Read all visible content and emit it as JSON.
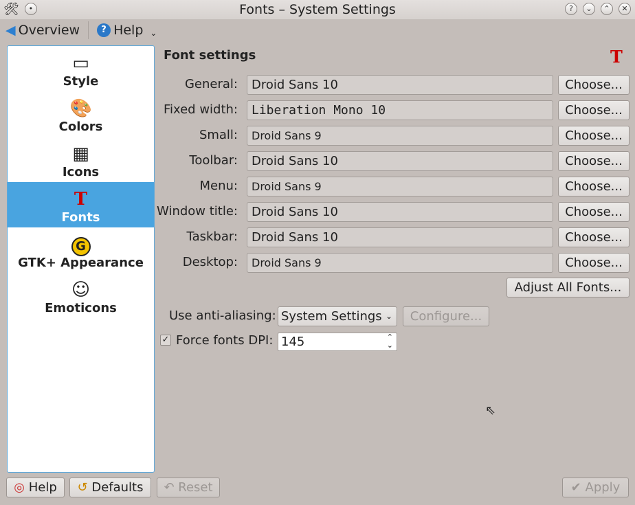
{
  "window": {
    "title": "Fonts – System Settings"
  },
  "toolbar": {
    "overview": "Overview",
    "help": "Help"
  },
  "sidebar": {
    "items": [
      {
        "label": "Style",
        "icon": "style-icon",
        "selected": false
      },
      {
        "label": "Colors",
        "icon": "colors-icon",
        "selected": false
      },
      {
        "label": "Icons",
        "icon": "icons-icon",
        "selected": false
      },
      {
        "label": "Fonts",
        "icon": "fonts-icon",
        "selected": true
      },
      {
        "label": "GTK+ Appearance",
        "icon": "gtk-icon",
        "selected": false
      },
      {
        "label": "Emoticons",
        "icon": "emoticons-icon",
        "selected": false
      }
    ]
  },
  "main": {
    "heading": "Font settings",
    "choose_label": "Choose...",
    "fonts": [
      {
        "label": "General:",
        "value": "Droid Sans 10"
      },
      {
        "label": "Fixed width:",
        "value": "Liberation Mono 10"
      },
      {
        "label": "Small:",
        "value": "Droid Sans 9"
      },
      {
        "label": "Toolbar:",
        "value": "Droid Sans 10"
      },
      {
        "label": "Menu:",
        "value": "Droid Sans 9"
      },
      {
        "label": "Window title:",
        "value": "Droid Sans 10"
      },
      {
        "label": "Taskbar:",
        "value": "Droid Sans 10"
      },
      {
        "label": "Desktop:",
        "value": "Droid Sans 9"
      }
    ],
    "adjust_all": "Adjust All Fonts...",
    "antialias_label": "Use anti-aliasing:",
    "antialias_value": "System Settings",
    "configure": "Configure...",
    "dpi_label": "Force fonts DPI:",
    "dpi_checked": true,
    "dpi_value": "145"
  },
  "footer": {
    "help": "Help",
    "defaults": "Defaults",
    "reset": "Reset",
    "apply": "Apply"
  }
}
